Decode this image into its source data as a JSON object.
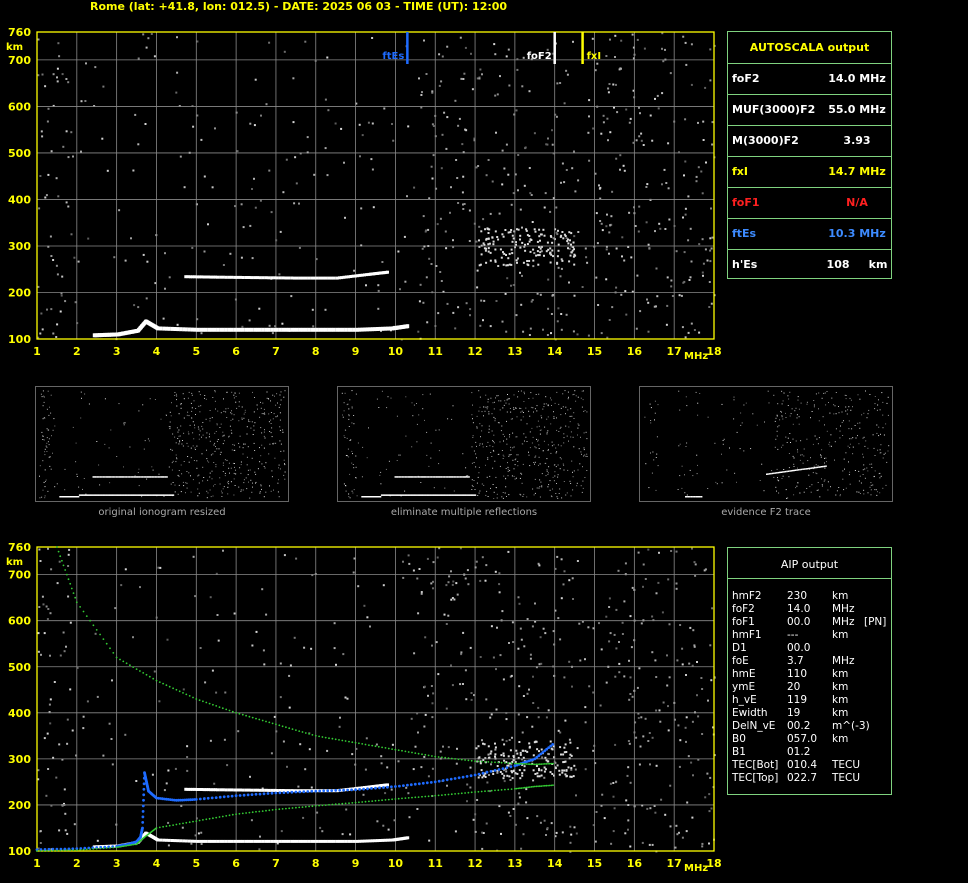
{
  "header": "Rome (lat: +41.8, lon: 012.5) - DATE: 2025 06 03 - TIME (UT): 12:00",
  "colors": {
    "axis": "#ffff00",
    "grid": "#8a8a8a",
    "frame": "#7fd27f",
    "blue": "#1e6bff",
    "green": "#33cc33",
    "red": "#ff2020"
  },
  "axes": {
    "y_unit": "km",
    "x_unit": "MHz",
    "y_ticks": [
      "760",
      "700",
      "600",
      "500",
      "400",
      "300",
      "200",
      "100"
    ],
    "x_ticks": [
      "1",
      "2",
      "3",
      "4",
      "5",
      "6",
      "7",
      "8",
      "9",
      "10",
      "11",
      "12",
      "13",
      "14",
      "15",
      "16",
      "17",
      "18"
    ]
  },
  "markers": {
    "ftEs": "ftEs",
    "foF2": "foF2",
    "fxI": "fxI"
  },
  "autoscala": {
    "title": "AUTOSCALA output",
    "rows": [
      {
        "label": "foF2",
        "value": "14.0 MHz",
        "color": "#ffffff"
      },
      {
        "label": "MUF(3000)F2",
        "value": "55.0 MHz",
        "color": "#ffffff"
      },
      {
        "label": "M(3000)F2",
        "value": "3.93",
        "color": "#ffffff"
      },
      {
        "label": "fxI",
        "value": "14.7 MHz",
        "color": "#ffff00"
      },
      {
        "label": "foF1",
        "value": "N/A",
        "color": "#ff2020"
      },
      {
        "label": "ftEs",
        "value": "10.3 MHz",
        "color": "#3d8bff"
      },
      {
        "label": "h'Es",
        "value": "108     km",
        "color": "#ffffff"
      }
    ]
  },
  "thumbs": {
    "cap1": "original ionogram resized",
    "cap2": "eliminate multiple reflections",
    "cap3": "evidence F2 trace"
  },
  "aip": {
    "title": "AIP output",
    "rows": [
      {
        "k": "hmF2",
        "v": "230",
        "u": "km",
        "x": ""
      },
      {
        "k": "foF2",
        "v": "14.0",
        "u": "MHz",
        "x": ""
      },
      {
        "k": "foF1",
        "v": "00.0",
        "u": "MHz",
        "x": "[PN]"
      },
      {
        "k": "hmF1",
        "v": "---",
        "u": "km",
        "x": ""
      },
      {
        "k": "D1",
        "v": "00.0",
        "u": "",
        "x": ""
      },
      {
        "k": "foE",
        "v": "3.7",
        "u": "MHz",
        "x": ""
      },
      {
        "k": "hmE",
        "v": "110",
        "u": "km",
        "x": ""
      },
      {
        "k": "ymE",
        "v": "20",
        "u": "km",
        "x": ""
      },
      {
        "k": "h_vE",
        "v": "119",
        "u": "km",
        "x": ""
      },
      {
        "k": "Ewidth",
        "v": "19",
        "u": "km",
        "x": ""
      },
      {
        "k": "DelN_vE",
        "v": "00.2",
        "u": "m^(-3)",
        "x": ""
      },
      {
        "k": "B0",
        "v": "057.0",
        "u": "km",
        "x": ""
      },
      {
        "k": "B1",
        "v": "01.2",
        "u": "",
        "x": ""
      },
      {
        "k": "TEC[Bot]",
        "v": "010.4",
        "u": "TECU",
        "x": ""
      },
      {
        "k": "TEC[Top]",
        "v": "022.7",
        "u": "TECU",
        "x": ""
      }
    ]
  },
  "chart_data": [
    {
      "type": "scatter",
      "xlabel": "MHz",
      "ylabel": "km",
      "xlim": [
        1,
        18
      ],
      "ylim": [
        100,
        760
      ],
      "grid": true,
      "series": [
        {
          "name": "",
          "x": [
            2.4,
            3.0,
            3.5,
            3.7,
            4.0,
            5,
            6,
            7,
            8,
            9,
            9.9,
            10.3
          ],
          "y": [
            110,
            112,
            120,
            140,
            125,
            122,
            122,
            122,
            122,
            122,
            125,
            130
          ]
        },
        {
          "name": "",
          "x": [
            4.7,
            5.5,
            6.5,
            7.5,
            8.5,
            9.3,
            9.8
          ],
          "y": [
            235,
            234,
            233,
            232,
            232,
            240,
            245
          ]
        }
      ],
      "annotations": [
        {
          "label": "ftEs",
          "x": 10.3
        },
        {
          "label": "foF2",
          "x": 14.0
        },
        {
          "label": "fxI",
          "x": 14.7
        }
      ]
    },
    {
      "type": "line",
      "xlabel": "MHz",
      "ylabel": "km",
      "xlim": [
        1,
        18
      ],
      "ylim": [
        100,
        760
      ],
      "grid": true,
      "series": [
        {
          "name": "",
          "x": [
            1.0,
            2.0,
            3.0,
            3.3,
            3.5,
            3.6,
            3.65,
            3.7,
            3.75,
            3.8,
            4.0,
            4.5,
            5,
            6,
            7,
            8,
            9,
            10,
            11,
            12,
            13,
            13.5,
            14.0
          ],
          "y": [
            103,
            105,
            110,
            115,
            120,
            130,
            150,
            270,
            250,
            230,
            215,
            210,
            212,
            220,
            226,
            230,
            233,
            240,
            250,
            265,
            285,
            300,
            335
          ]
        },
        {
          "name": "",
          "x": [
            1.5,
            2,
            3,
            4,
            5,
            6,
            7,
            8,
            9,
            10,
            11,
            12,
            13,
            13.5,
            14.0
          ],
          "y": [
            760,
            640,
            520,
            470,
            430,
            400,
            375,
            350,
            335,
            320,
            305,
            295,
            290,
            288,
            290
          ]
        },
        {
          "name": "",
          "x": [
            1.0,
            2.0,
            3.0,
            3.5,
            3.7,
            4,
            5,
            6,
            7,
            8,
            9,
            10,
            11,
            12,
            13,
            13.5,
            14.0
          ],
          "y": [
            100,
            102,
            108,
            115,
            130,
            150,
            165,
            180,
            190,
            198,
            205,
            213,
            220,
            228,
            235,
            240,
            243
          ]
        }
      ]
    }
  ]
}
